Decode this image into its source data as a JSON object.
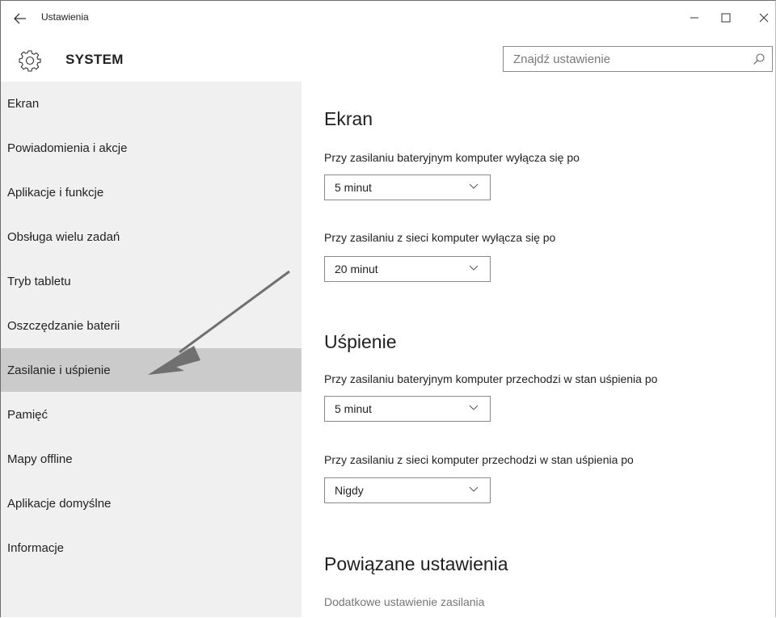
{
  "window": {
    "title": "Ustawienia",
    "back_icon": "back-arrow-icon",
    "controls": {
      "minimize": "minimize-icon",
      "maximize": "maximize-icon",
      "close": "close-icon"
    }
  },
  "header": {
    "icon": "gear-icon",
    "title": "SYSTEM",
    "search": {
      "placeholder": "Znajdź ustawienie",
      "value": "",
      "icon": "search-icon"
    }
  },
  "sidebar": {
    "items": [
      {
        "label": "Ekran",
        "selected": false
      },
      {
        "label": "Powiadomienia i akcje",
        "selected": false
      },
      {
        "label": "Aplikacje i funkcje",
        "selected": false
      },
      {
        "label": "Obsługa wielu zadań",
        "selected": false
      },
      {
        "label": "Tryb tabletu",
        "selected": false
      },
      {
        "label": "Oszczędzanie baterii",
        "selected": false
      },
      {
        "label": "Zasilanie i uśpienie",
        "selected": true
      },
      {
        "label": "Pamięć",
        "selected": false
      },
      {
        "label": "Mapy offline",
        "selected": false
      },
      {
        "label": "Aplikacje domyślne",
        "selected": false
      },
      {
        "label": "Informacje",
        "selected": false
      }
    ]
  },
  "main": {
    "screen": {
      "heading": "Ekran",
      "battery_label": "Przy zasilaniu bateryjnym komputer wyłącza się po",
      "battery_value": "5 minut",
      "ac_label": "Przy zasilaniu z sieci komputer wyłącza się po",
      "ac_value": "20 minut"
    },
    "sleep": {
      "heading": "Uśpienie",
      "battery_label": "Przy zasilaniu bateryjnym komputer przechodzi w stan uśpienia po",
      "battery_value": "5 minut",
      "ac_label": "Przy zasilaniu z sieci komputer przechodzi w stan uśpienia po",
      "ac_value": "Nigdy"
    },
    "related": {
      "heading": "Powiązane ustawienia",
      "link": "Dodatkowe ustawienie zasilania"
    }
  },
  "colors": {
    "sidebar_bg": "#f0f0f0",
    "selected_bg": "#cbcbcb",
    "annotation_arrow": "#707070"
  }
}
